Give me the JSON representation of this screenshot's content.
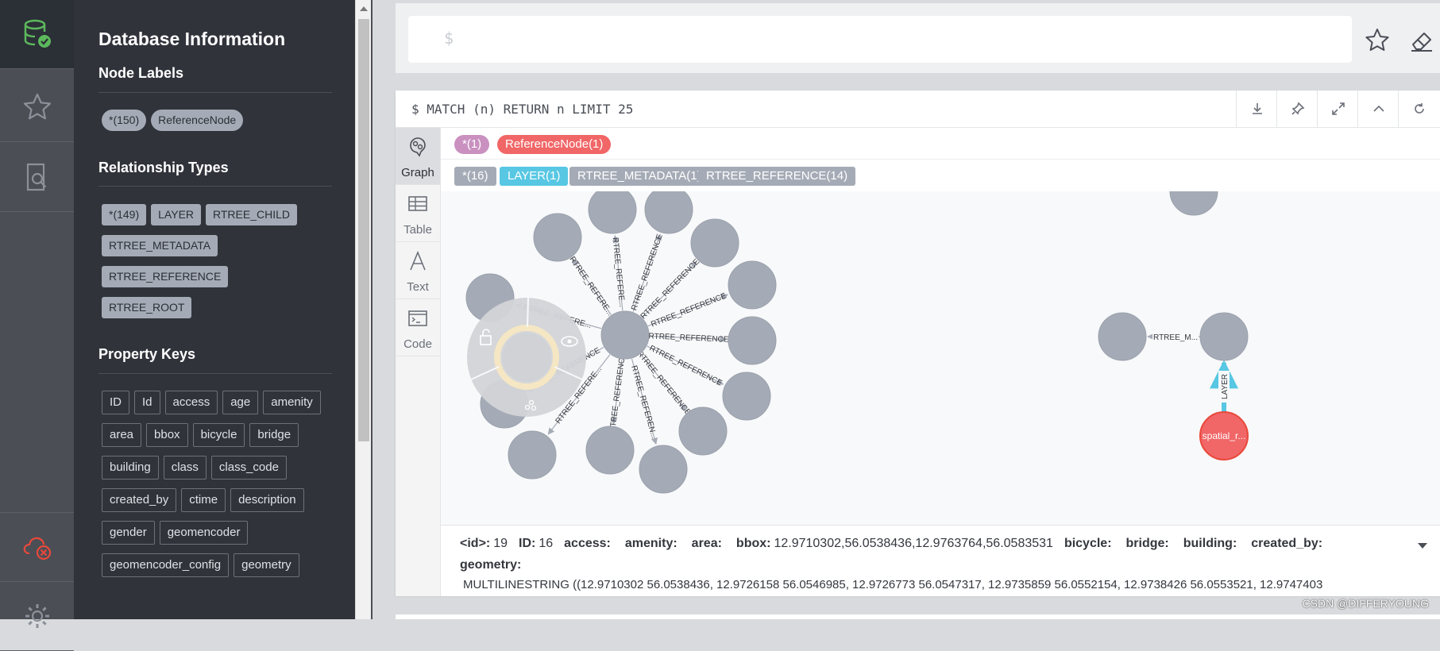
{
  "colors": {
    "rail_bg": "#4b4e55",
    "drawer_bg": "#30333a",
    "node_gray": "#a5abb6",
    "node_red": "#f16667",
    "rel_layer": "#57c7e3",
    "star_node_chip": "#c990c0",
    "db_icon_green": "#5cb85c",
    "disconnect_red": "#e9483a"
  },
  "rail": {
    "items": [
      {
        "icon": "database-check-icon"
      },
      {
        "icon": "star-icon"
      },
      {
        "icon": "document-search-icon"
      },
      {
        "icon": "cloud-disconnected-icon"
      },
      {
        "icon": "gear-icon"
      }
    ]
  },
  "drawer": {
    "title": "Database Information",
    "node_labels": {
      "heading": "Node Labels",
      "items": [
        "*(150)",
        "ReferenceNode"
      ]
    },
    "relationship_types": {
      "heading": "Relationship Types",
      "items": [
        "*(149)",
        "LAYER",
        "RTREE_CHILD",
        "RTREE_METADATA",
        "RTREE_REFERENCE",
        "RTREE_ROOT"
      ]
    },
    "property_keys": {
      "heading": "Property Keys",
      "items": [
        "ID",
        "Id",
        "access",
        "age",
        "amenity",
        "area",
        "bbox",
        "bicycle",
        "bridge",
        "building",
        "class",
        "class_code",
        "created_by",
        "ctime",
        "description",
        "gender",
        "geomencoder",
        "geomencoder_config",
        "geometry"
      ]
    }
  },
  "editor": {
    "prompt": "$"
  },
  "frame": {
    "query": "$ MATCH (n) RETURN n LIMIT 25",
    "actions": [
      "download-icon",
      "pin-icon",
      "expand-icon",
      "collapse-icon",
      "rerun-icon"
    ],
    "tabs": [
      {
        "label": "Graph",
        "icon": "graph-icon",
        "active": true
      },
      {
        "label": "Table",
        "icon": "table-icon",
        "active": false
      },
      {
        "label": "Text",
        "icon": "text-icon",
        "active": false
      },
      {
        "label": "Code",
        "icon": "code-icon",
        "active": false
      }
    ],
    "legend_nodes": [
      {
        "label": "*(1)",
        "color": "#c990c0"
      },
      {
        "label": "ReferenceNode(1)",
        "color": "#f16667"
      }
    ],
    "legend_rels": [
      {
        "label": "*(16)",
        "color": "#a5abb6"
      },
      {
        "label": "LAYER(1)",
        "color": "#57c7e3"
      },
      {
        "label": "RTREE_METADATA(1)",
        "color": "#a5abb6"
      },
      {
        "label": "RTREE_REFERENCE(14)",
        "color": "#a5abb6"
      }
    ],
    "graph": {
      "star_rel_label": "RTREE_REFERENCE",
      "short_labels": [
        "RTREE_REFERE...",
        "RTREE_REFERE...",
        "RTREE_REFERENCE",
        "RTREE_REFERENCE",
        "RTREE_REFERENCE",
        "RTREE_REFERENCE",
        "RTREE_REFERENCE",
        "RTREE_REFERENCE",
        "RTREE_REFEREN...",
        "RTREE_REFERENCE",
        "RTREE_REFERE...",
        "RTREE_REFERENCE"
      ],
      "metadata_label": "RTREE_M...",
      "layer_label": "LAYER",
      "red_node_caption": "spatial_r..."
    },
    "properties": {
      "row1": [
        {
          "key": "<id>:",
          "value": "19"
        },
        {
          "key": "ID:",
          "value": "16"
        },
        {
          "key": "access:",
          "value": ""
        },
        {
          "key": "amenity:",
          "value": ""
        },
        {
          "key": "area:",
          "value": ""
        },
        {
          "key": "bbox:",
          "value": "12.9710302,56.0538436,12.9763764,56.0583531"
        },
        {
          "key": "bicycle:",
          "value": ""
        },
        {
          "key": "bridge:",
          "value": ""
        },
        {
          "key": "building:",
          "value": ""
        },
        {
          "key": "created_by:",
          "value": ""
        }
      ],
      "row2_key": "geometry:",
      "row3": "MULTILINESTRING ((12.9710302 56.0538436, 12.9726158 56.0546985, 12.9726773 56.0547317, 12.9735859 56.0552154, 12.9738426 56.0553521, 12.9747403"
    }
  },
  "watermark": "CSDN @DIFFERYOUNG"
}
